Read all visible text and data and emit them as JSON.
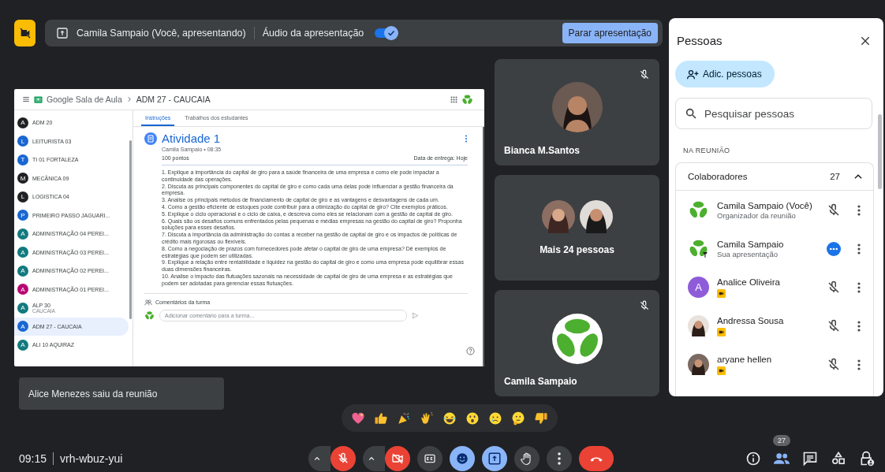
{
  "presenting_bar": {
    "presenter": "Camila Sampaio (Você, apresentando)",
    "audio_label": "Áudio da apresentação",
    "audio_on": true,
    "stop_button": "Parar apresentação"
  },
  "shared_screen": {
    "app_title": "Google Sala de Aula",
    "breadcrumb": "ADM 27 - CAUCAIA",
    "classes": [
      {
        "initial": "A",
        "name": "ADM 20",
        "color": "#202124",
        "selected": false
      },
      {
        "initial": "L",
        "name": "LEITURISTA 03",
        "color": "#1967d2",
        "selected": false
      },
      {
        "initial": "T",
        "name": "TI 01 FORTALEZA",
        "color": "#1967d2",
        "selected": false
      },
      {
        "initial": "M",
        "name": "MECÂNICA 09",
        "color": "#202124",
        "selected": false
      },
      {
        "initial": "L",
        "name": "LOGISTICA 04",
        "color": "#202124",
        "selected": false
      },
      {
        "initial": "P",
        "name": "PRIMEIRO PASSO JAGUARI...",
        "color": "#1967d2",
        "selected": false
      },
      {
        "initial": "A",
        "name": "ADMINISTRAÇÃO 04 PEREI...",
        "color": "#137a7f",
        "selected": false
      },
      {
        "initial": "A",
        "name": "ADMINISTRAÇÃO 03 PEREI...",
        "color": "#137a7f",
        "selected": false
      },
      {
        "initial": "A",
        "name": "ADMINISTRAÇÃO 02 PEREI...",
        "color": "#137a7f",
        "selected": false
      },
      {
        "initial": "A",
        "name": "ADMINISTRAÇÃO 01 PEREI...",
        "color": "#b80672",
        "selected": false
      },
      {
        "initial": "A",
        "name": "ALP 30",
        "subtitle": "CAUCAIA",
        "color": "#137a7f",
        "selected": false
      },
      {
        "initial": "A",
        "name": "ADM 27 - CAUCAIA",
        "color": "#1967d2",
        "selected": true
      },
      {
        "initial": "A",
        "name": "ALI 10 AQUIRAZ",
        "color": "#137a7f",
        "selected": false
      }
    ],
    "tabs": [
      {
        "label": "Instruções",
        "selected": true
      },
      {
        "label": "Trabalhos dos estudantes",
        "selected": false
      }
    ],
    "assignment": {
      "title": "Atividade 1",
      "meta": "Camila Sampaio • 08:35",
      "points": "100 pontos",
      "due": "Data de entrega: Hoje",
      "questions": [
        "1. Explique a importância do capital de giro para a saúde financeira de uma empresa e como ele pode impactar a continuidade das operações.",
        "2. Discuta as principais componentes do capital de giro e como cada uma delas pode influenciar a gestão financeira da empresa.",
        "3. Analise os principais métodos de financiamento de capital de giro e as vantagens e desvantagens de cada um.",
        "4. Como a gestão eficiente de estoques pode contribuir para a otimização do capital de giro? Cite exemplos práticos.",
        "5. Explique o ciclo operacional e o ciclo de caixa, e descreva como eles se relacionam com a gestão de capital de giro.",
        "6. Quais são os desafios comuns enfrentados pelas pequenas e médias empresas na gestão do capital de giro? Proponha soluções para esses desafios.",
        "7. Discuta a importância da administração do contas a receber na gestão de capital de giro e os impactos de políticas de crédito mais rigorosas ou flexíveis.",
        "8. Como a negociação de prazos com fornecedores pode afetar o capital de giro de uma empresa? Dê exemplos de estratégias que podem ser utilizadas.",
        "9. Explique a relação entre rentabilidade e liquidez na gestão do capital de giro e como uma empresa pode equilibrar essas duas dimensões financeiras.",
        "10. Analise o impacto das flutuações sazonais na necessidade de capital de giro de uma empresa e as estratégias que podem ser adotadas para gerenciar essas flutuações."
      ],
      "comments_label": "Comentários da turma",
      "comment_placeholder": "Adicionar comentário para a turma..."
    }
  },
  "tiles": [
    {
      "kind": "photo",
      "name": "Bianca M.Santos",
      "muted": true
    },
    {
      "kind": "group",
      "name": "Mais 24 pessoas"
    },
    {
      "kind": "logo",
      "name": "Camila Sampaio",
      "muted": true
    }
  ],
  "people_panel": {
    "title": "Pessoas",
    "add_button": "Adic. pessoas",
    "search": {
      "placeholder": "Pesquisar pessoas"
    },
    "section": "NA REUNIÃO",
    "group": {
      "name": "Colaboradores",
      "count": "27",
      "expanded": true,
      "participants": [
        {
          "kind": "logo",
          "name": "Camila Sampaio (Você)",
          "subtitle": "Organizador da reunião",
          "muted": true
        },
        {
          "kind": "presentation",
          "name": "Camila Sampaio",
          "subtitle": "Sua apresentação",
          "presenting": true
        },
        {
          "kind": "letter",
          "initial": "A",
          "color": "#8e5cd9",
          "name": "Analice Oliveira",
          "muted": true,
          "badge": true
        },
        {
          "kind": "photo",
          "name": "Andressa Sousa",
          "muted": true,
          "badge": true
        },
        {
          "kind": "photo",
          "name": "aryane hellen",
          "muted": true,
          "badge": true
        }
      ]
    }
  },
  "toast": "Alice Menezes saiu da reunião",
  "reactions": [
    {
      "kind": "heart"
    },
    {
      "kind": "thumbs_up"
    },
    {
      "kind": "party"
    },
    {
      "kind": "clap"
    },
    {
      "kind": "laugh"
    },
    {
      "kind": "surprised"
    },
    {
      "kind": "cry"
    },
    {
      "kind": "thinking"
    },
    {
      "kind": "thumbs_down"
    }
  ],
  "bottom_bar": {
    "time": "09:15",
    "meeting_code": "vrh-wbuz-yui",
    "controls": [
      {
        "kind": "mic",
        "on": false
      },
      {
        "kind": "camera",
        "on": false
      },
      {
        "kind": "captions",
        "on": false
      },
      {
        "kind": "reactions",
        "on": true
      },
      {
        "kind": "present",
        "on": true
      },
      {
        "kind": "hand",
        "on": false
      },
      {
        "kind": "more"
      },
      {
        "kind": "end"
      }
    ],
    "side_buttons": [
      {
        "kind": "info",
        "selected": false
      },
      {
        "kind": "people",
        "selected": true,
        "badge": "27"
      },
      {
        "kind": "chat",
        "selected": false
      },
      {
        "kind": "activities",
        "selected": false
      },
      {
        "kind": "host",
        "selected": false
      }
    ]
  }
}
